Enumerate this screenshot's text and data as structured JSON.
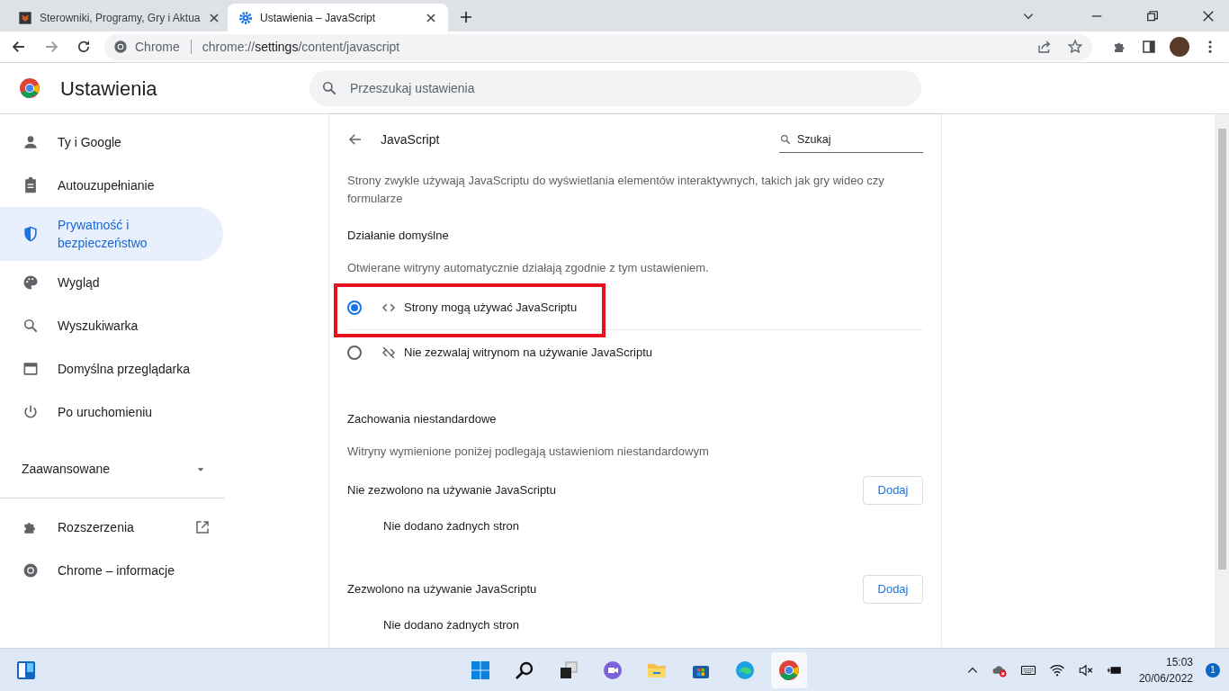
{
  "tabs": [
    {
      "title": "Sterowniki, Programy, Gry i Aktua",
      "selected": false,
      "kind": "site"
    },
    {
      "title": "Ustawienia – JavaScript",
      "selected": true,
      "kind": "settings"
    }
  ],
  "address": {
    "label": "Chrome",
    "url": "chrome://**settings**/content/javascript"
  },
  "header": {
    "title": "Ustawienia",
    "search_placeholder": "Przeszukaj ustawienia"
  },
  "sidebar": {
    "items": [
      {
        "label": "Ty i Google",
        "selected": false,
        "kind": "person"
      },
      {
        "label": "Autouzupełnianie",
        "selected": false,
        "kind": "clipboard"
      },
      {
        "label": "Prywatność i bezpieczeństwo",
        "selected": true,
        "kind": "shield"
      },
      {
        "label": "Wygląd",
        "selected": false,
        "kind": "palette"
      },
      {
        "label": "Wyszukiwarka",
        "selected": false,
        "kind": "search"
      },
      {
        "label": "Domyślna przeglądarka",
        "selected": false,
        "kind": "browser"
      },
      {
        "label": "Po uruchomieniu",
        "selected": false,
        "kind": "power"
      }
    ],
    "advanced": {
      "label": "Zaawansowane",
      "expanded": false
    },
    "extra": [
      {
        "label": "Rozszerzenia",
        "kind": "puzzle",
        "external": true
      },
      {
        "label": "Chrome – informacje",
        "kind": "chrome",
        "external": false
      }
    ]
  },
  "page": {
    "title": "JavaScript",
    "search_placeholder": "Szukaj",
    "description": "Strony zwykle używają JavaScriptu do wyświetlania elementów interaktywnych, takich jak gry wideo czy formularze",
    "default_title": "Działanie domyślne",
    "default_subtitle": "Otwierane witryny automatycznie działają zgodnie z tym ustawieniem.",
    "options": [
      {
        "label": "Strony mogą używać JavaScriptu",
        "selected": true,
        "highlighted": true,
        "kind": "code"
      },
      {
        "label": "Nie zezwalaj witrynom na używanie JavaScriptu",
        "selected": false,
        "highlighted": false,
        "kind": "code-off"
      }
    ],
    "custom_title": "Zachowania niestandardowe",
    "custom_subtitle": "Witryny wymienione poniżej podlegają ustawieniom niestandardowym",
    "groups": [
      {
        "label": "Nie zezwolono na używanie JavaScriptu",
        "button": "Dodaj",
        "empty": "Nie dodano żadnych stron"
      },
      {
        "label": "Zezwolono na używanie JavaScriptu",
        "button": "Dodaj",
        "empty": "Nie dodano żadnych stron"
      }
    ]
  },
  "taskbar": {
    "time": "15:03",
    "date": "20/06/2022",
    "notifications": "1"
  }
}
